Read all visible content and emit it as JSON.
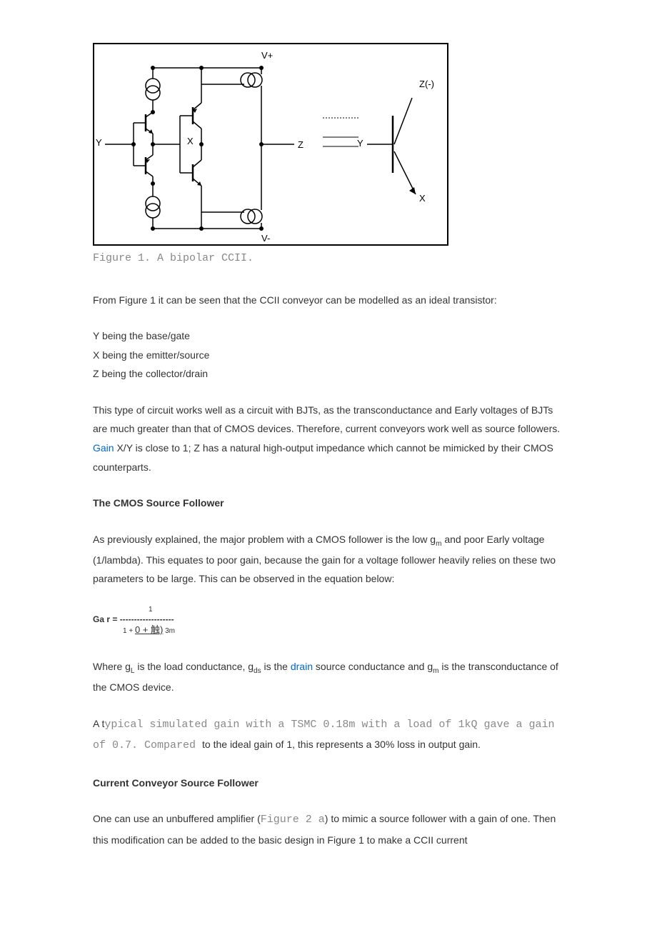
{
  "figure": {
    "caption": "Figure 1. A bipolar CCII.",
    "labels": {
      "vplus": "V+",
      "vminus": "V-",
      "y": "Y",
      "x": "X",
      "z": "Z",
      "zneg": "Z(-)",
      "y2": "Y",
      "x2": "X"
    }
  },
  "p1": "From Figure 1 it can be seen that the CCII conveyor can be modelled as an ideal transistor:",
  "list": {
    "l1": "Y being the base/gate",
    "l2": "X being the emitter/source",
    "l3": "Z being the collector/drain"
  },
  "p2a": "This type of circuit works well as a circuit with BJTs, as the transconductance and Early voltages of BJTs are much greater than that of CMOS devices. Therefore, current conveyors work well as source followers. ",
  "p2_link": "Gain",
  "p2b": " X/Y is close to 1; Z has a natural high-output impedance which cannot be mimicked by their CMOS counterparts.",
  "h1": "The CMOS Source Follower",
  "p3a": "As previously explained, the major problem with a CMOS follower is the low g",
  "p3_sub1": "m",
  "p3b": " and poor Early voltage (1/lambda). This equates to poor gain, because the gain for a voltage follower heavily relies on these two parameters to be large. This can be observed in the equation below:",
  "eq": {
    "num": "1",
    "lhs": "Ga r = ",
    "dashes": "-------------------",
    "den_pre": "1 + ",
    "den_u": "0  +  触)",
    "den_post": "  3m"
  },
  "p4a": "Where g",
  "p4_sub1": "L",
  "p4b": " is the load conductance, g",
  "p4_sub2": "ds",
  "p4c": " is the ",
  "p4_link": "drain",
  "p4d": " source conductance and g",
  "p4_sub3": "m",
  "p4e": " is the transconductance of the CMOS device.",
  "p5a": "A t",
  "p5_mono": "ypical simulated gain with a TSMC 0.18m with a load of 1kQ gave a gain of 0.7. Compared ",
  "p5b": " to the ideal gain of 1, this represents a 30% loss in output gain.",
  "h2": "Current Conveyor Source Follower",
  "p6a": "One can use an unbuffered amplifier (",
  "p6_mono": "Figure 2 a",
  "p6b": ") to mimic a source follower with a gain of one. Then this modification can be added to the basic design in Figure 1 to make a CCII current"
}
